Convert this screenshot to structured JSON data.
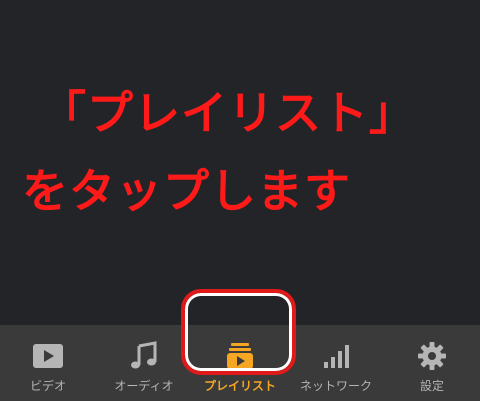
{
  "instruction": {
    "line1": "「プレイリスト」",
    "line2": "をタップします"
  },
  "tabs": [
    {
      "id": "video",
      "label": "ビデオ",
      "icon": "video-play-icon",
      "active": false
    },
    {
      "id": "audio",
      "label": "オーディオ",
      "icon": "music-note-icon",
      "active": false
    },
    {
      "id": "playlist",
      "label": "プレイリスト",
      "icon": "playlist-icon",
      "active": true
    },
    {
      "id": "network",
      "label": "ネットワーク",
      "icon": "signal-bars-icon",
      "active": false
    },
    {
      "id": "settings",
      "label": "設定",
      "icon": "gear-icon",
      "active": false
    }
  ],
  "colors": {
    "background": "#222428",
    "tab_bar": "#3a3a3a",
    "icon_inactive": "#b5b5b5",
    "accent": "#f5a623",
    "instruction_text": "#ff1a1a",
    "highlight": "#e01919"
  }
}
